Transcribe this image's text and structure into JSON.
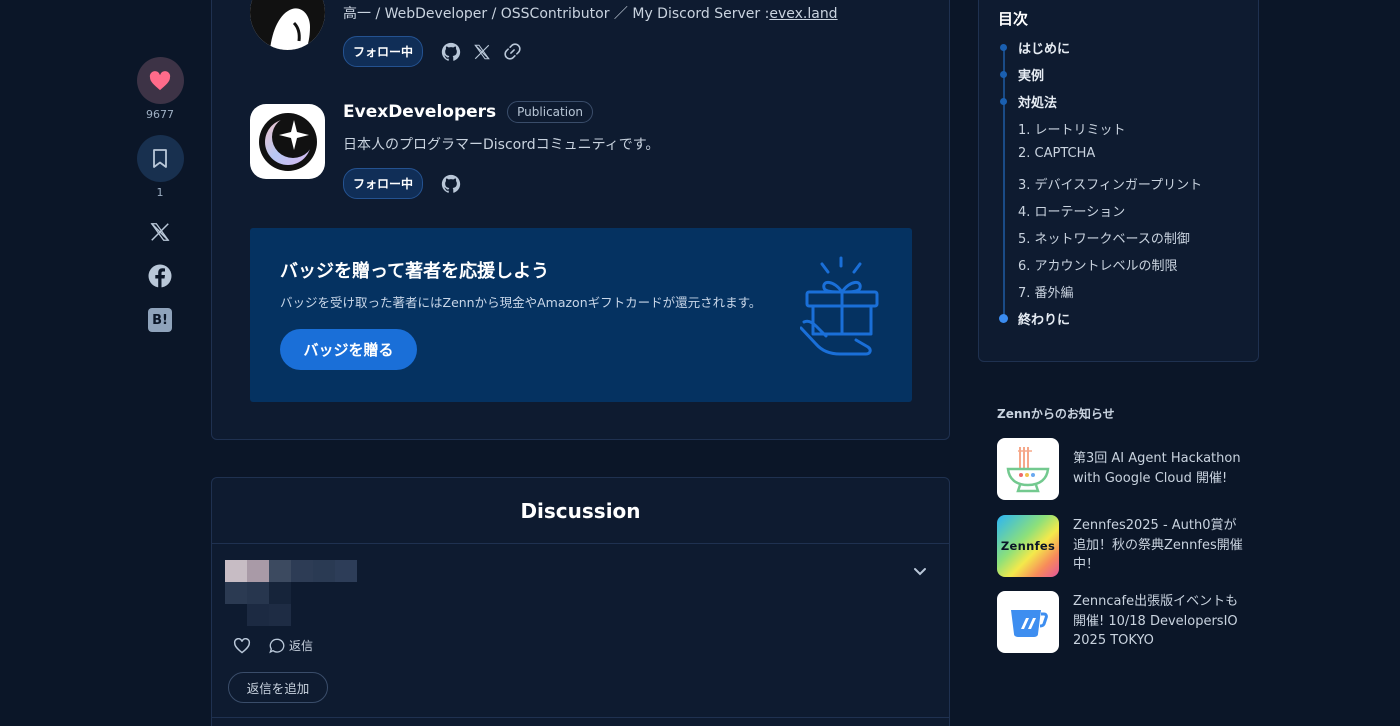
{
  "rail": {
    "like_count": "9677",
    "bookmark_count": "1",
    "hatena_label": "B!"
  },
  "authors": [
    {
      "bio_prefix": "高一 / WebDeveloper / OSSContributor ／ My Discord Server :",
      "bio_link": "evex.land",
      "follow_label": "フォロー中"
    },
    {
      "name": "EvexDevelopers",
      "badge": "Publication",
      "bio": "日本人のプログラマーDiscordコミュニティです。",
      "follow_label": "フォロー中"
    }
  ],
  "badge_panel": {
    "title": "バッジを贈って著者を応援しよう",
    "description": "バッジを受け取った著者にはZennから現金やAmazonギフトカードが還元されます。",
    "button_label": "バッジを贈る"
  },
  "discussion": {
    "title": "Discussion",
    "reply_label": "返信",
    "add_reply_label": "返信を追加"
  },
  "toc": {
    "title": "目次",
    "items": [
      {
        "label": "はじめに",
        "level": 1
      },
      {
        "label": "実例",
        "level": 1
      },
      {
        "label": "対処法",
        "level": 1
      },
      {
        "label": "1. レートリミット",
        "level": 2
      },
      {
        "label": "2. CAPTCHA",
        "level": 2
      },
      {
        "label": "3. デバイスフィンガープリント",
        "level": 2
      },
      {
        "label": "4. ローテーション",
        "level": 2
      },
      {
        "label": "5. ネットワークベースの制御",
        "level": 2
      },
      {
        "label": "6. アカウントレベルの制限",
        "level": 2
      },
      {
        "label": "7. 番外編",
        "level": 2
      },
      {
        "label": "終わりに",
        "level": 1,
        "current": true
      }
    ]
  },
  "news": {
    "heading": "Zennからのお知らせ",
    "items": [
      {
        "text": "第3回 AI Agent Hackathon with Google Cloud 開催!"
      },
      {
        "text": "Zennfes2025 - Auth0賞が追加！秋の祭典Zennfes開催中！",
        "thumb_label": "Zennfes"
      },
      {
        "text": "Zenncafe出張版イベントも開催! 10/18 DevelopersIO 2025 TOKYO"
      }
    ]
  },
  "colors": {
    "page_bg": "#0b1628",
    "card_bg": "#0e1b30",
    "badge_panel_bg": "#053261",
    "accent": "#1a6fd8",
    "like": "#ff6b8a"
  }
}
